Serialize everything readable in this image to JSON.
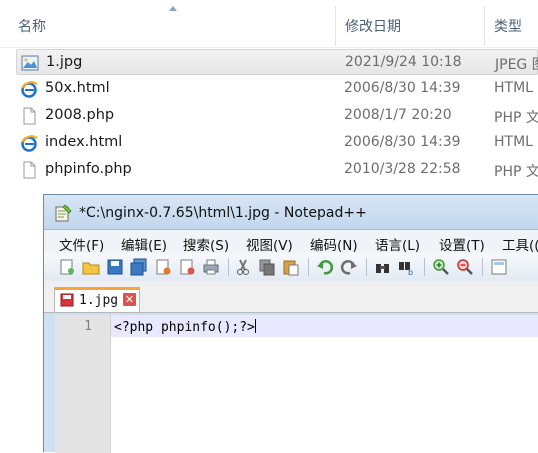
{
  "explorer": {
    "columns": {
      "name": "名称",
      "modified": "修改日期",
      "type": "类型"
    },
    "files": [
      {
        "name": "1.jpg",
        "date": "2021/9/24 10:18",
        "type": "JPEG 图",
        "icon": "jpeg-image-icon",
        "selected": true
      },
      {
        "name": "50x.html",
        "date": "2006/8/30 14:39",
        "type": "HTML",
        "icon": "ie-html-icon",
        "selected": false
      },
      {
        "name": "2008.php",
        "date": "2008/1/7 20:20",
        "type": "PHP 文",
        "icon": "blank-file-icon",
        "selected": false
      },
      {
        "name": "index.html",
        "date": "2006/8/30 14:39",
        "type": "HTML",
        "icon": "ie-html-icon",
        "selected": false
      },
      {
        "name": "phpinfo.php",
        "date": "2010/3/28 22:58",
        "type": "PHP 文",
        "icon": "blank-file-icon",
        "selected": false
      }
    ]
  },
  "notepad": {
    "title": "*C:\\nginx-0.7.65\\html\\1.jpg - Notepad++",
    "menu": [
      "文件(F)",
      "编辑(E)",
      "搜索(S)",
      "视图(V)",
      "编码(N)",
      "语言(L)",
      "设置(T)",
      "工具(("
    ],
    "toolbar_icons": [
      "new-file-icon",
      "open-file-icon",
      "save-icon",
      "save-all-icon",
      "close-icon",
      "close-all-icon",
      "print-icon",
      "cut-icon",
      "copy-icon",
      "paste-icon",
      "undo-icon",
      "redo-icon",
      "find-icon",
      "replace-icon",
      "zoom-in-icon",
      "zoom-out-icon",
      "sync-icon"
    ],
    "tab": {
      "label": "1.jpg",
      "close": "✕"
    },
    "editor": {
      "line_number": "1",
      "code": "<?php phpinfo();?>"
    },
    "colors": {
      "tab_accent": "#f3a640",
      "current_line": "#e8e8ff",
      "gutter": "#e4e4e4"
    }
  }
}
